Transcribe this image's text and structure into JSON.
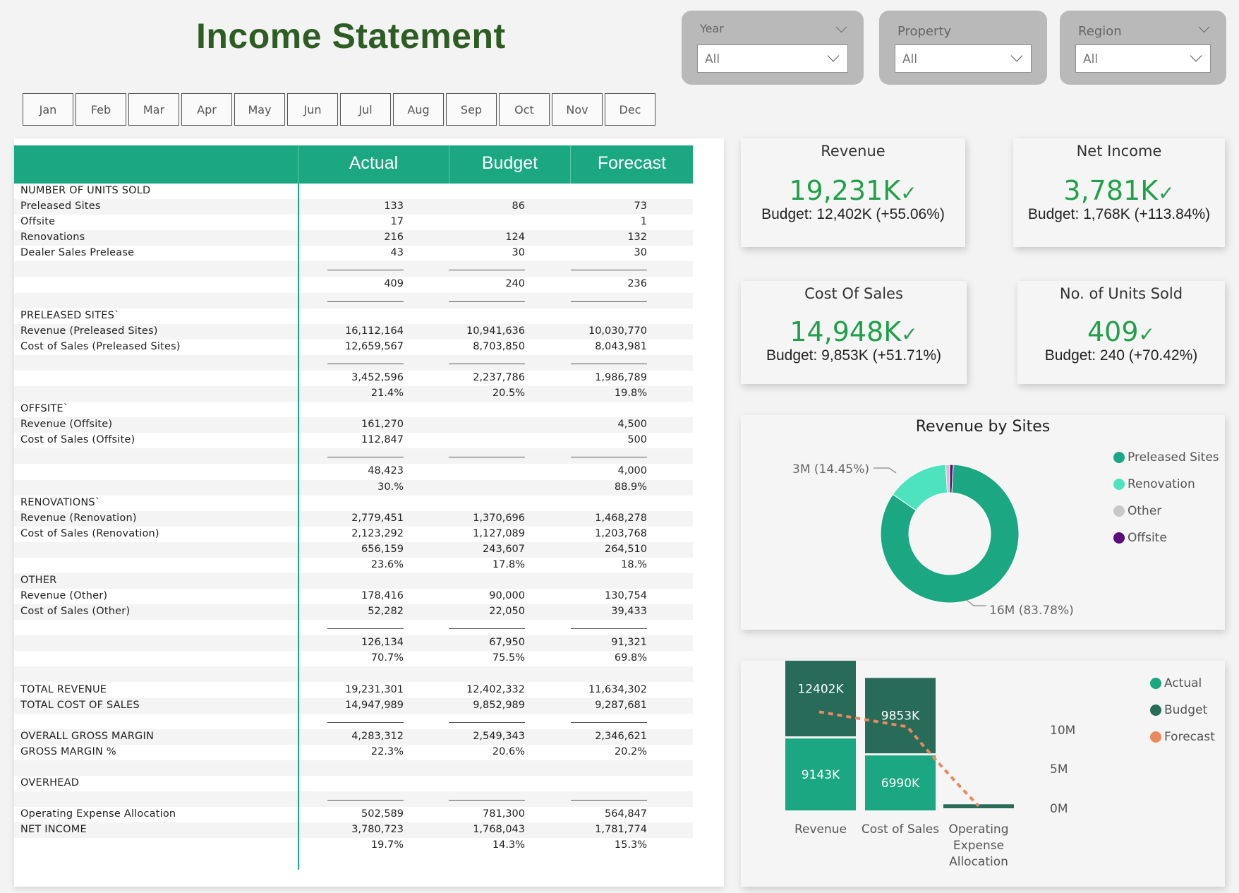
{
  "title": "Income Statement",
  "slicers": [
    {
      "label": "Year",
      "value": "All"
    },
    {
      "label": "Property",
      "value": "All"
    },
    {
      "label": "Region",
      "value": "All"
    }
  ],
  "months": [
    "Jan",
    "Feb",
    "Mar",
    "Apr",
    "May",
    "Jun",
    "Jul",
    "Aug",
    "Sep",
    "Oct",
    "Nov",
    "Dec"
  ],
  "table": {
    "columns": [
      "Actual",
      "Budget",
      "Forecast"
    ],
    "rows": [
      {
        "label": "NUMBER OF UNITS SOLD",
        "v": [
          "",
          "",
          ""
        ]
      },
      {
        "label": "Preleased Sites",
        "v": [
          "133",
          "86",
          "73"
        ]
      },
      {
        "label": "Offsite",
        "v": [
          "17",
          "",
          "1"
        ]
      },
      {
        "label": "Renovations",
        "v": [
          "216",
          "124",
          "132"
        ]
      },
      {
        "label": "Dealer Sales Prelease",
        "v": [
          "43",
          "30",
          "30"
        ]
      },
      {
        "label": "",
        "v": [
          "",
          "",
          ""
        ],
        "ul": [
          1,
          1,
          1
        ]
      },
      {
        "label": "",
        "v": [
          "409",
          "240",
          "236"
        ]
      },
      {
        "label": "",
        "v": [
          "",
          "",
          ""
        ],
        "ul": [
          1,
          1,
          1
        ]
      },
      {
        "label": "PRELEASED SITES`",
        "v": [
          "",
          "",
          ""
        ]
      },
      {
        "label": "Revenue (Preleased Sites)",
        "v": [
          "16,112,164",
          "10,941,636",
          "10,030,770"
        ]
      },
      {
        "label": "Cost of Sales (Preleased Sites)",
        "v": [
          "12,659,567",
          "8,703,850",
          "8,043,981"
        ]
      },
      {
        "label": "",
        "v": [
          "",
          "",
          ""
        ],
        "ul": [
          1,
          1,
          1
        ]
      },
      {
        "label": "",
        "v": [
          "3,452,596",
          "2,237,786",
          "1,986,789"
        ]
      },
      {
        "label": "",
        "v": [
          "21.4%",
          "20.5%",
          "19.8%"
        ]
      },
      {
        "label": "OFFSITE`",
        "v": [
          "",
          "",
          ""
        ]
      },
      {
        "label": "Revenue (Offsite)",
        "v": [
          "161,270",
          "",
          "4,500"
        ]
      },
      {
        "label": "Cost of Sales (Offsite)",
        "v": [
          "112,847",
          "",
          "500"
        ]
      },
      {
        "label": "",
        "v": [
          "",
          "",
          ""
        ],
        "ul": [
          1,
          1,
          1
        ]
      },
      {
        "label": "",
        "v": [
          "48,423",
          "",
          "4,000"
        ]
      },
      {
        "label": "",
        "v": [
          "30.%",
          "",
          "88.9%"
        ]
      },
      {
        "label": "RENOVATIONS`",
        "v": [
          "",
          "",
          ""
        ]
      },
      {
        "label": "Revenue (Renovation)",
        "v": [
          "2,779,451",
          "1,370,696",
          "1,468,278"
        ]
      },
      {
        "label": "Cost of Sales (Renovation)",
        "v": [
          "2,123,292",
          "1,127,089",
          "1,203,768"
        ]
      },
      {
        "label": "",
        "v": [
          "656,159",
          "243,607",
          "264,510"
        ]
      },
      {
        "label": "",
        "v": [
          "23.6%",
          "17.8%",
          "18.%"
        ]
      },
      {
        "label": "OTHER",
        "v": [
          "",
          "",
          ""
        ]
      },
      {
        "label": "Revenue (Other)",
        "v": [
          "178,416",
          "90,000",
          "130,754"
        ]
      },
      {
        "label": "Cost of Sales (Other)",
        "v": [
          "52,282",
          "22,050",
          "39,433"
        ]
      },
      {
        "label": "",
        "v": [
          "",
          "",
          ""
        ],
        "ul": [
          1,
          1,
          1
        ]
      },
      {
        "label": "",
        "v": [
          "126,134",
          "67,950",
          "91,321"
        ]
      },
      {
        "label": "",
        "v": [
          "70.7%",
          "75.5%",
          "69.8%"
        ]
      },
      {
        "label": "",
        "v": [
          "",
          "",
          ""
        ]
      },
      {
        "label": "TOTAL REVENUE",
        "v": [
          "19,231,301",
          "12,402,332",
          "11,634,302"
        ]
      },
      {
        "label": "TOTAL COST OF SALES",
        "v": [
          "14,947,989",
          "9,852,989",
          "9,287,681"
        ]
      },
      {
        "label": "",
        "v": [
          "",
          "",
          ""
        ],
        "ul": [
          1,
          1,
          1
        ]
      },
      {
        "label": "OVERALL GROSS MARGIN",
        "v": [
          "4,283,312",
          "2,549,343",
          "2,346,621"
        ]
      },
      {
        "label": "GROSS MARGIN %",
        "v": [
          "22.3%",
          "20.6%",
          "20.2%"
        ]
      },
      {
        "label": "",
        "v": [
          "",
          "",
          ""
        ]
      },
      {
        "label": "OVERHEAD",
        "v": [
          "",
          "",
          ""
        ]
      },
      {
        "label": "",
        "v": [
          "",
          "",
          ""
        ],
        "ul": [
          1,
          1,
          1
        ]
      },
      {
        "label": "Operating Expense Allocation",
        "v": [
          "502,589",
          "781,300",
          "564,847"
        ]
      },
      {
        "label": "NET INCOME",
        "v": [
          "3,780,723",
          "1,768,043",
          "1,781,774"
        ]
      },
      {
        "label": "",
        "v": [
          "19.7%",
          "14.3%",
          "15.3%"
        ]
      }
    ]
  },
  "kpis": [
    {
      "title": "Revenue",
      "value": "19,231K",
      "sub": "Budget: 12,402K (+55.06%)"
    },
    {
      "title": "Net Income",
      "value": "3,781K",
      "sub": "Budget: 1,768K (+113.84%)"
    },
    {
      "title": "Cost Of Sales",
      "value": "14,948K",
      "sub": "Budget: 9,853K (+51.71%)"
    },
    {
      "title": "No. of Units Sold",
      "value": "409",
      "sub": "Budget: 240 (+70.42%)"
    }
  ],
  "colors": {
    "accent": "#1aa781",
    "kpi_green": "#21a04a",
    "title_green": "#2e5d24",
    "preleased": "#1aa781",
    "renovation": "#4ee3bf",
    "other": "#c8c8c8",
    "offsite": "#5b0c7a",
    "actual": "#1aa781",
    "budget": "#276b58",
    "forecast": "#e8895e"
  },
  "chart_data": [
    {
      "type": "pie",
      "title": "Revenue by Sites",
      "categories": [
        "Preleased Sites",
        "Renovation",
        "Other",
        "Offsite"
      ],
      "values": [
        16112164,
        2779451,
        178416,
        161270
      ],
      "data_labels": [
        {
          "text": "3M (14.45%)"
        },
        {
          "text": "16M (83.78%)"
        }
      ],
      "legend": "right"
    },
    {
      "type": "bar",
      "title": "",
      "categories": [
        "Revenue",
        "Cost of Sales",
        "Operating Expense Allocation"
      ],
      "category_lines": [
        [
          "Revenue"
        ],
        [
          "Cost of Sales"
        ],
        [
          "Operating",
          "Expense",
          "Allocation"
        ]
      ],
      "series": [
        {
          "name": "Actual",
          "values": [
            9143,
            6990,
            0
          ],
          "labels": [
            "9143K",
            "6990K",
            ""
          ]
        },
        {
          "name": "Budget",
          "values": [
            12402,
            9853,
            781
          ],
          "labels": [
            "12402K",
            "9853K",
            ""
          ]
        },
        {
          "name": "Forecast",
          "values": [
            11634,
            9288,
            565
          ]
        }
      ],
      "yticks": [
        {
          "v": 0,
          "label": "0M"
        },
        {
          "v": 5000,
          "label": "5M"
        },
        {
          "v": 10000,
          "label": "10M"
        }
      ],
      "ylim": [
        0,
        14000
      ],
      "legend": "top-right"
    }
  ]
}
